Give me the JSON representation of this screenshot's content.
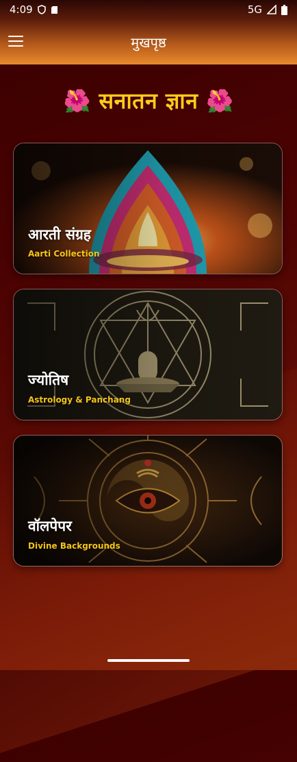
{
  "status": {
    "time": "4:09",
    "network": "5G"
  },
  "appbar": {
    "title": "मुखपृष्ठ"
  },
  "heading": {
    "emoji": "🌺",
    "text": "सनातन ज्ञान"
  },
  "cards": [
    {
      "title": "आरती संग्रह",
      "subtitle": "Aarti Collection"
    },
    {
      "title": "ज्योतिष",
      "subtitle": "Astrology & Panchang"
    },
    {
      "title": "वॉलपेपर",
      "subtitle": "Divine Backgrounds"
    }
  ],
  "colors": {
    "accent": "#ffcc1a",
    "subtitle": "#f5c518",
    "appbar_bottom": "#e98a2c"
  }
}
